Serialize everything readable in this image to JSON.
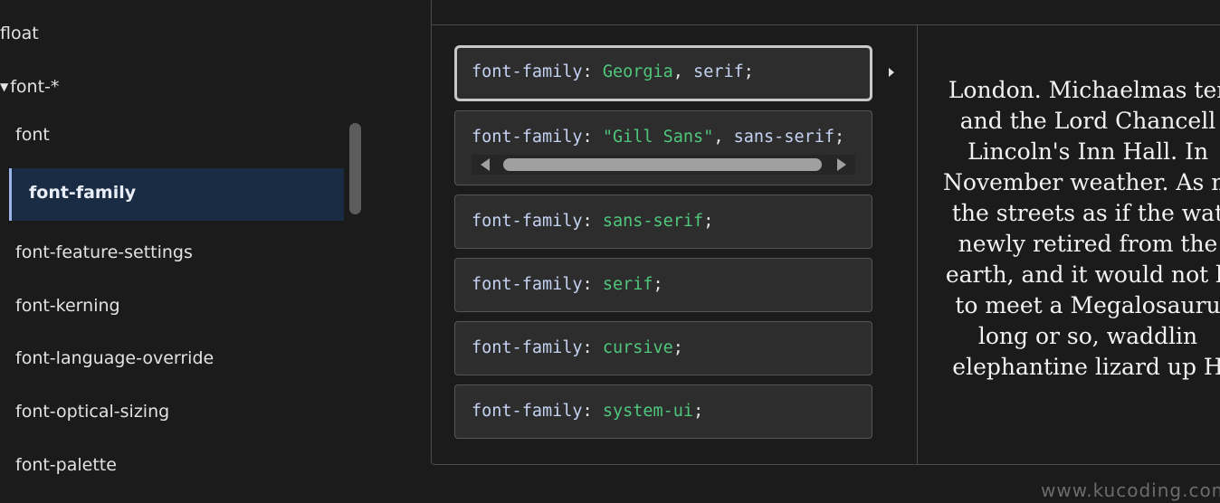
{
  "sidebar": {
    "float_label": "float",
    "group_label": "font-*",
    "items": [
      {
        "label": "font"
      },
      {
        "label": "font-family"
      },
      {
        "label": "font-feature-settings"
      },
      {
        "label": "font-kerning"
      },
      {
        "label": "font-language-override"
      },
      {
        "label": "font-optical-sizing"
      },
      {
        "label": "font-palette"
      }
    ]
  },
  "choices": [
    {
      "prop": "font-family",
      "colon": ": ",
      "values": [
        {
          "text": "Georgia",
          "kind": "val"
        },
        {
          "text": ", ",
          "kind": "punc"
        },
        {
          "text": "serif",
          "kind": "prop"
        },
        {
          "text": ";",
          "kind": "punc"
        }
      ]
    },
    {
      "prop": "font-family",
      "colon": ": ",
      "values": [
        {
          "text": "\"Gill Sans\"",
          "kind": "str"
        },
        {
          "text": ", ",
          "kind": "punc"
        },
        {
          "text": "sans-serif",
          "kind": "prop"
        },
        {
          "text": ";",
          "kind": "punc"
        }
      ]
    },
    {
      "prop": "font-family",
      "colon": ": ",
      "values": [
        {
          "text": "sans-serif",
          "kind": "val"
        },
        {
          "text": ";",
          "kind": "punc"
        }
      ]
    },
    {
      "prop": "font-family",
      "colon": ": ",
      "values": [
        {
          "text": "serif",
          "kind": "val"
        },
        {
          "text": ";",
          "kind": "punc"
        }
      ]
    },
    {
      "prop": "font-family",
      "colon": ": ",
      "values": [
        {
          "text": "cursive",
          "kind": "val"
        },
        {
          "text": ";",
          "kind": "punc"
        }
      ]
    },
    {
      "prop": "font-family",
      "colon": ": ",
      "values": [
        {
          "text": "system-ui",
          "kind": "val"
        },
        {
          "text": ";",
          "kind": "punc"
        }
      ]
    }
  ],
  "preview": {
    "lines": [
      "London. Michaelmas ter",
      "and the Lord Chancell",
      "Lincoln's Inn Hall. In",
      "November weather. As m",
      "the streets as if the wat",
      "newly retired from the",
      "earth, and it would not b",
      "to meet a Megalosauru",
      "long or so, waddlin",
      "elephantine lizard up H"
    ]
  },
  "watermark": "www.kucoding.com",
  "colors": {
    "background": "#1b1b1b",
    "active_item_bg": "#1a2c44",
    "value_green": "#4fc67c",
    "property_blue": "#c4d2f2"
  }
}
